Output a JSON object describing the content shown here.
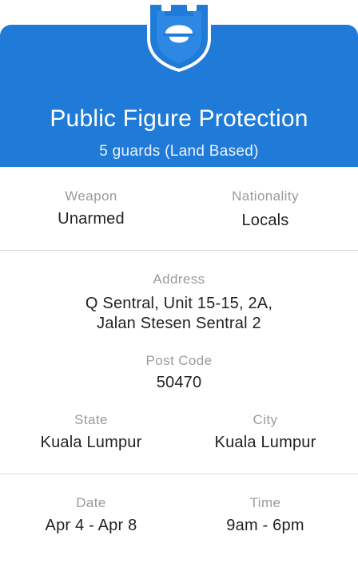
{
  "header": {
    "title": "Public Figure Protection",
    "subtitle": "5 guards (Land Based)",
    "badge_icon": "guard-shield-icon",
    "color": "#1f7ad8"
  },
  "details": {
    "weapon_label": "Weapon",
    "weapon_value": "Unarmed",
    "nationality_label": "Nationality",
    "nationality_value": "Locals",
    "address_label": "Address",
    "address_line1": "Q Sentral, Unit 15-15, 2A,",
    "address_line2": "Jalan Stesen Sentral 2",
    "postcode_label": "Post Code",
    "postcode_value": "50470",
    "state_label": "State",
    "state_value": "Kuala Lumpur",
    "city_label": "City",
    "city_value": "Kuala Lumpur",
    "date_label": "Date",
    "date_value": "Apr 4 - Apr 8",
    "time_label": "Time",
    "time_value": "9am - 6pm"
  }
}
